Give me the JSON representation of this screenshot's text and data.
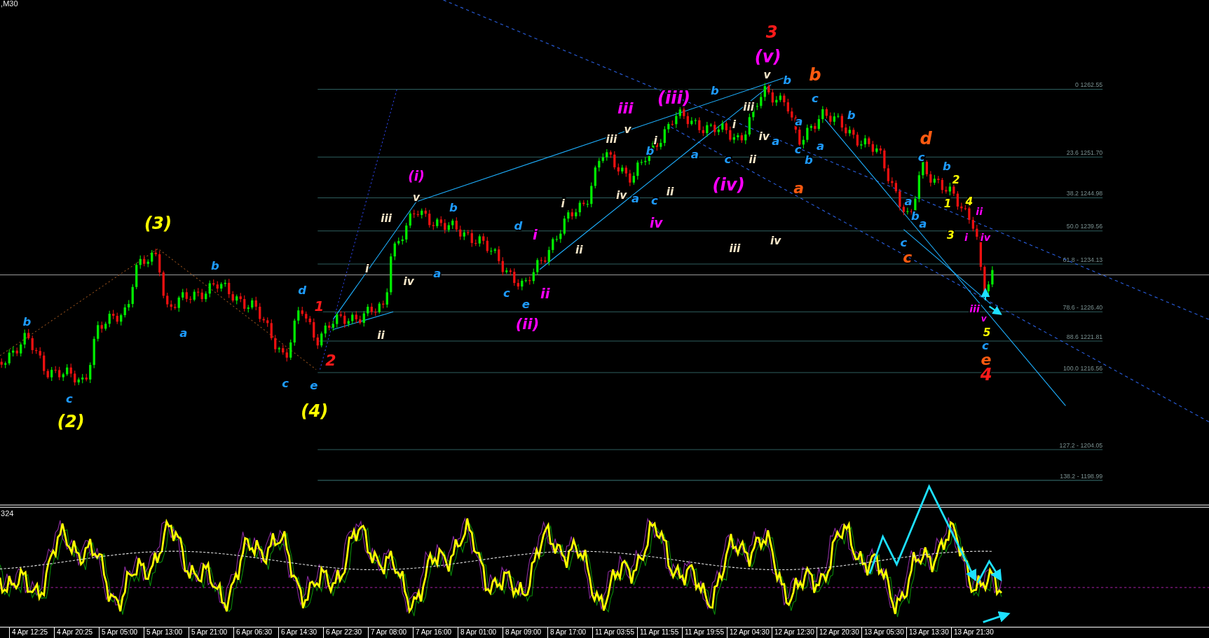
{
  "chart": {
    "title": ",M30",
    "fib_levels": [
      {
        "label": "0 1262.55"
      },
      {
        "label": "23.6 1251.70"
      },
      {
        "label": "38.2 1244.98"
      },
      {
        "label": "50.0 1239.56"
      },
      {
        "label": "61.8 - 1234.13"
      },
      {
        "label": "78.6 - 1226.40"
      },
      {
        "label": "88.6 1221.81"
      },
      {
        "label": "100.0 1216.56"
      },
      {
        "label": "127.2 - 1204.05"
      },
      {
        "label": "138.2 - 1198.99"
      }
    ],
    "wave_labels": [
      {
        "text": "(3)",
        "color": "#ffff00"
      },
      {
        "text": "(2)",
        "color": "#ffff00"
      },
      {
        "text": "(4)",
        "color": "#ffff00"
      },
      {
        "text": "b",
        "color": "#1e9bff"
      },
      {
        "text": "c",
        "color": "#1e9bff"
      },
      {
        "text": "a",
        "color": "#1e9bff"
      },
      {
        "text": "b",
        "color": "#1e9bff"
      },
      {
        "text": "d",
        "color": "#1e9bff"
      },
      {
        "text": "c",
        "color": "#1e9bff"
      },
      {
        "text": "e",
        "color": "#1e9bff"
      },
      {
        "text": "a",
        "color": "#1e9bff"
      },
      {
        "text": "b",
        "color": "#1e9bff"
      },
      {
        "text": "d",
        "color": "#1e9bff"
      },
      {
        "text": "c",
        "color": "#1e9bff"
      },
      {
        "text": "e",
        "color": "#1e9bff"
      },
      {
        "text": "b",
        "color": "#1e9bff"
      },
      {
        "text": "a",
        "color": "#1e9bff"
      },
      {
        "text": "c",
        "color": "#1e9bff"
      },
      {
        "text": "a",
        "color": "#1e9bff"
      },
      {
        "text": "c",
        "color": "#1e9bff"
      },
      {
        "text": "b",
        "color": "#1e9bff"
      },
      {
        "text": "b",
        "color": "#1e9bff"
      },
      {
        "text": "a",
        "color": "#1e9bff"
      },
      {
        "text": "a",
        "color": "#1e9bff"
      },
      {
        "text": "c",
        "color": "#1e9bff"
      },
      {
        "text": "b",
        "color": "#1e9bff"
      },
      {
        "text": "a",
        "color": "#1e9bff"
      },
      {
        "text": "c",
        "color": "#1e9bff"
      },
      {
        "text": "b",
        "color": "#1e9bff"
      },
      {
        "text": "c",
        "color": "#1e9bff"
      },
      {
        "text": "b",
        "color": "#1e9bff"
      },
      {
        "text": "a",
        "color": "#1e9bff"
      },
      {
        "text": "b",
        "color": "#1e9bff"
      },
      {
        "text": "c",
        "color": "#1e9bff"
      },
      {
        "text": "a",
        "color": "#1e9bff"
      },
      {
        "text": "c",
        "color": "#1e9bff"
      },
      {
        "text": "1",
        "color": "#ff1a1a"
      },
      {
        "text": "2",
        "color": "#ff1a1a"
      },
      {
        "text": "3",
        "color": "#ff1a1a"
      },
      {
        "text": "4",
        "color": "#ff1a1a"
      },
      {
        "text": "b",
        "color": "#ff5a10"
      },
      {
        "text": "d",
        "color": "#ff5a10"
      },
      {
        "text": "a",
        "color": "#ff5a10"
      },
      {
        "text": "c",
        "color": "#ff5a10"
      },
      {
        "text": "e",
        "color": "#ff5a10"
      },
      {
        "text": "(i)",
        "color": "#ff00ff"
      },
      {
        "text": "(ii)",
        "color": "#ff00ff"
      },
      {
        "text": "(iii)",
        "color": "#ff00ff"
      },
      {
        "text": "(iv)",
        "color": "#ff00ff"
      },
      {
        "text": "(v)",
        "color": "#ff00ff"
      },
      {
        "text": "iii",
        "color": "#ff00ff"
      },
      {
        "text": "iv",
        "color": "#ff00ff"
      },
      {
        "text": "i",
        "color": "#ff00ff"
      },
      {
        "text": "ii",
        "color": "#ff00ff"
      },
      {
        "text": "iii",
        "color": "#ff00ff"
      },
      {
        "text": "v",
        "color": "#ff00ff"
      },
      {
        "text": "ii",
        "color": "#ff00ff"
      },
      {
        "text": "i",
        "color": "#ff00ff"
      },
      {
        "text": "iv",
        "color": "#ff00ff"
      },
      {
        "text": "v",
        "color": "#f5e6c8"
      },
      {
        "text": "iii",
        "color": "#f5e6c8"
      },
      {
        "text": "iv",
        "color": "#f5e6c8"
      },
      {
        "text": "i",
        "color": "#f5e6c8"
      },
      {
        "text": "ii",
        "color": "#f5e6c8"
      },
      {
        "text": "i",
        "color": "#f5e6c8"
      },
      {
        "text": "ii",
        "color": "#f5e6c8"
      },
      {
        "text": "iii",
        "color": "#f5e6c8"
      },
      {
        "text": "v",
        "color": "#f5e6c8"
      },
      {
        "text": "iv",
        "color": "#f5e6c8"
      },
      {
        "text": "i",
        "color": "#f5e6c8"
      },
      {
        "text": "ii",
        "color": "#f5e6c8"
      },
      {
        "text": "iii",
        "color": "#f5e6c8"
      },
      {
        "text": "i",
        "color": "#f5e6c8"
      },
      {
        "text": "iv",
        "color": "#f5e6c8"
      },
      {
        "text": "ii",
        "color": "#f5e6c8"
      },
      {
        "text": "v",
        "color": "#f5e6c8"
      },
      {
        "text": "iii",
        "color": "#f5e6c8"
      },
      {
        "text": "iv",
        "color": "#f5e6c8"
      },
      {
        "text": "2",
        "color": "#ffff00"
      },
      {
        "text": "1",
        "color": "#ffff00"
      },
      {
        "text": "4",
        "color": "#ffff00"
      },
      {
        "text": "3",
        "color": "#ffff00"
      },
      {
        "text": "5",
        "color": "#ffff00"
      }
    ]
  },
  "indicator": {
    "label": "324"
  },
  "time_axis": [
    "4 Apr 12:25",
    "4 Apr 20:25",
    "5 Apr 05:00",
    "5 Apr 13:00",
    "5 Apr 21:00",
    "6 Apr 06:30",
    "6 Apr 14:30",
    "6 Apr 22:30",
    "7 Apr 08:00",
    "7 Apr 16:00",
    "8 Apr 01:00",
    "8 Apr 09:00",
    "8 Apr 17:00",
    "11 Apr 03:55",
    "11 Apr 11:55",
    "11 Apr 19:55",
    "12 Apr 04:30",
    "12 Apr 12:30",
    "12 Apr 20:30",
    "13 Apr 05:30",
    "13 Apr 13:30",
    "13 Apr 21:30"
  ]
}
